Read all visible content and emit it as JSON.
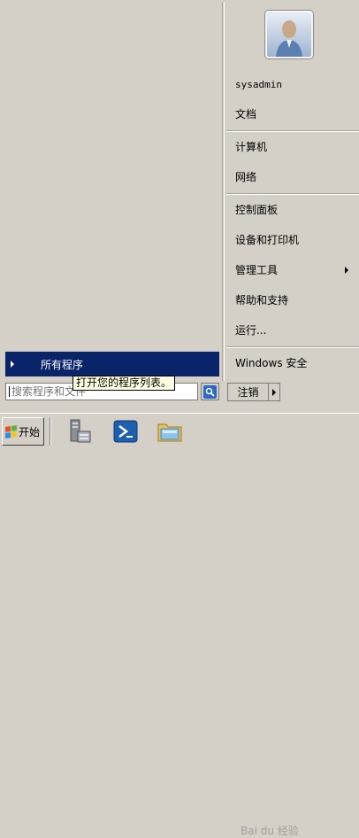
{
  "start_menu": {
    "all_programs_label": "所有程序",
    "tooltip": "打开您的程序列表。",
    "search_placeholder": "搜索程序和文件",
    "user_name": "sysadmin",
    "right_items": [
      {
        "label": "文档"
      },
      {
        "label": "计算机"
      },
      {
        "label": "网络"
      },
      {
        "label": "控制面板"
      },
      {
        "label": "设备和打印机"
      },
      {
        "label": "管理工具",
        "has_submenu": true
      },
      {
        "label": "帮助和支持"
      },
      {
        "label": "运行..."
      },
      {
        "label": "Windows 安全"
      }
    ],
    "logoff_label": "注销"
  },
  "taskbar": {
    "start_label": "开始",
    "pinned": [
      {
        "icon": "server-manager-icon"
      },
      {
        "icon": "powershell-icon"
      },
      {
        "icon": "file-explorer-icon"
      }
    ]
  },
  "watermark": "Bai du 经验",
  "colors": {
    "menu_bg": "#d4d0c8",
    "highlight": "#0a246a",
    "tooltip_bg": "#ffffe1"
  }
}
